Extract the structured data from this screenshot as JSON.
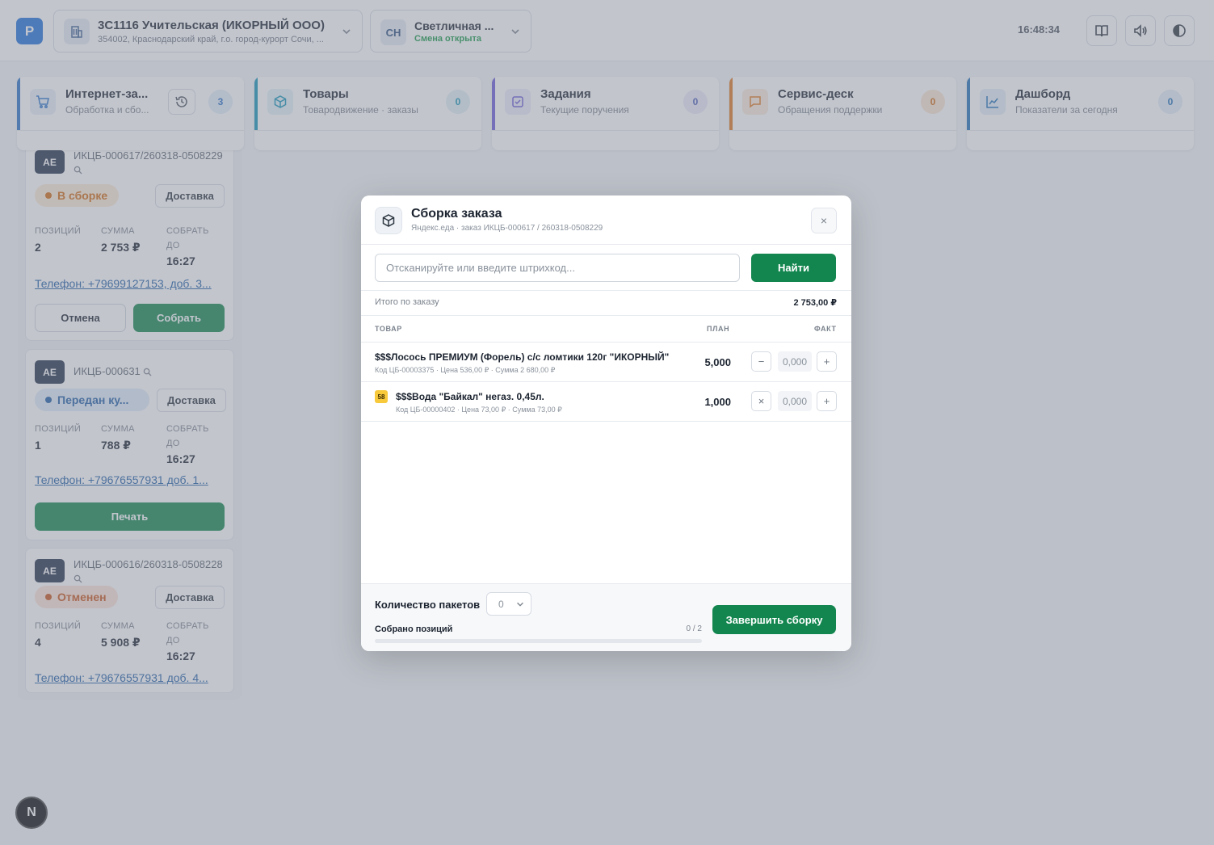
{
  "header": {
    "logo": "P",
    "store": {
      "title": "3С1116 Учительская (ИКОРНЫЙ ООО)",
      "address": "354002, Краснодарский край, г.о. город-курорт Сочи, ..."
    },
    "user": {
      "initials": "СН",
      "name": "Светличная ...",
      "shift": "Смена открыта"
    },
    "clock": "16:48:34"
  },
  "modules": [
    {
      "title": "Интернет-за...",
      "subtitle": "Обработка и сбо...",
      "count": "3",
      "color": "#2a72c8"
    },
    {
      "title": "Товары",
      "subtitle": "Товародвижение · заказы",
      "count": "0",
      "color": "#1595b8"
    },
    {
      "title": "Задания",
      "subtitle": "Текущие поручения",
      "count": "0",
      "color": "#6a5ad8"
    },
    {
      "title": "Сервис-деск",
      "subtitle": "Обращения поддержки",
      "count": "0",
      "color": "#e0781f"
    },
    {
      "title": "Дашборд",
      "subtitle": "Показатели за сегодня",
      "count": "0",
      "color": "#1f6fb8"
    }
  ],
  "orders": [
    {
      "badge": "AE",
      "number": "ИКЦБ-000617/260318-0508229",
      "status": "В сборке",
      "delivery": "Доставка",
      "lbl_pos": "ПОЗИЦИЙ",
      "lbl_sum": "СУММА",
      "lbl_due": "СОБРАТЬ ДО",
      "positions": "2",
      "sum": "2 753 ₽",
      "due": "16:27",
      "phone": "Телефон: +79699127153, доб. 3...",
      "cancel": "Отмена",
      "action": "Собрать"
    },
    {
      "badge": "AE",
      "number": "ИКЦБ-000631",
      "status": "Передан ку...",
      "delivery": "Доставка",
      "lbl_pos": "ПОЗИЦИЙ",
      "lbl_sum": "СУММА",
      "lbl_due": "СОБРАТЬ ДО",
      "positions": "1",
      "sum": "788 ₽",
      "due": "16:27",
      "phone": "Телефон: +79676557931 доб. 1...",
      "action": "Печать"
    },
    {
      "badge": "AE",
      "number": "ИКЦБ-000616/260318-0508228",
      "status": "Отменен",
      "delivery": "Доставка",
      "lbl_pos": "ПОЗИЦИЙ",
      "lbl_sum": "СУММА",
      "lbl_due": "СОБРАТЬ ДО",
      "positions": "4",
      "sum": "5 908 ₽",
      "due": "16:27",
      "phone": "Телефон: +79676557931 доб. 4..."
    }
  ],
  "modal": {
    "title": "Сборка заказа",
    "subtitle": "Яндекс.еда · заказ ИКЦБ-000617 / 260318-0508229",
    "close": "×",
    "scan_placeholder": "Отсканируйте или введите штрихкод...",
    "scan_value": "",
    "find": "Найти",
    "total_label": "Итого по заказу",
    "total_value": "2 753,00 ₽",
    "columns": {
      "product": "ТОВАР",
      "plan": "ПЛАН",
      "fact": "ФАКТ"
    },
    "items": [
      {
        "name": "$$$Лосось ПРЕМИУМ (Форель) с/с ломтики 120г \"ИКОРНЫЙ\"",
        "meta": "Код ЦБ-00003375 · Цена 536,00 ₽ · Сумма 2 680,00 ₽",
        "plan": "5,000",
        "fact": "0,000",
        "minus": "−",
        "plus": "+"
      },
      {
        "name": "$$$Вода \"Байкал\" негаз. 0,45л.",
        "meta": "Код ЦБ-00000402 · Цена 73,00 ₽ · Сумма 73,00 ₽",
        "plan": "1,000",
        "fact": "0,000",
        "minus": "×",
        "plus": "+",
        "icon": "58"
      }
    ],
    "packages_label": "Количество пакетов",
    "packages_value": "0",
    "collected_label": "Собрано позиций",
    "collected_count": "0 / 2",
    "collected_fraction": 0,
    "finish": "Завершить сборку"
  },
  "dev_badge": "N"
}
